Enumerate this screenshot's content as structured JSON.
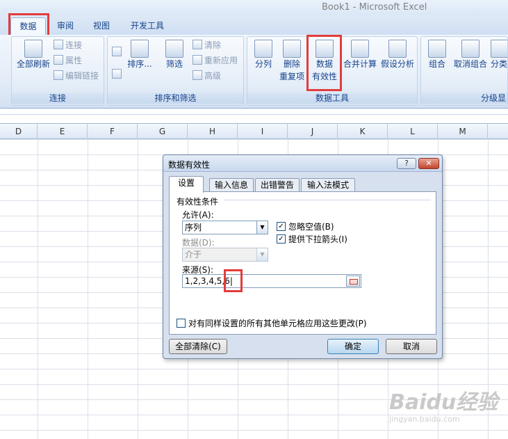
{
  "window": {
    "title": "Book1 - Microsoft Excel"
  },
  "ribbon_tabs": [
    "数据",
    "审阅",
    "视图",
    "开发工具"
  ],
  "active_tab": "数据",
  "groups": {
    "connections": {
      "label": "连接",
      "refresh_all": "全部刷新",
      "items": [
        "连接",
        "属性",
        "编辑链接"
      ]
    },
    "sort_filter": {
      "label": "排序和筛选",
      "sort": "排序...",
      "filter": "筛选",
      "items": [
        "清除",
        "重新应用",
        "高级"
      ]
    },
    "data_tools": {
      "label": "数据工具",
      "text_to_columns": "分列",
      "remove_duplicates_1": "删除",
      "remove_duplicates_2": "重复项",
      "data_validation_1": "数据",
      "data_validation_2": "有效性",
      "consolidate": "合并计算",
      "what_if": "假设分析"
    },
    "outline": {
      "label": "分级显",
      "group": "组合",
      "ungroup": "取消组合",
      "subtotal": "分类"
    }
  },
  "columns": [
    "D",
    "E",
    "F",
    "G",
    "H",
    "I",
    "J",
    "K",
    "L",
    "M"
  ],
  "dialog": {
    "title": "数据有效性",
    "help": "?",
    "close": "✕",
    "tabs": [
      "设置",
      "输入信息",
      "出错警告",
      "输入法模式"
    ],
    "section": "有效性条件",
    "allow_label": "允许(A):",
    "allow_value": "序列",
    "ignore_blank": "忽略空值(B)",
    "dropdown": "提供下拉箭头(I)",
    "data_label": "数据(D):",
    "data_value": "介于",
    "source_label": "来源(S):",
    "source_value": "1,2,3,4,5,6|",
    "apply_all": "对有同样设置的所有其他单元格应用这些更改(P)",
    "clear_all": "全部清除(C)",
    "ok": "确定",
    "cancel": "取消"
  },
  "watermark": {
    "logo": "Baidu经验",
    "url": "jingyan.baidu.com"
  }
}
